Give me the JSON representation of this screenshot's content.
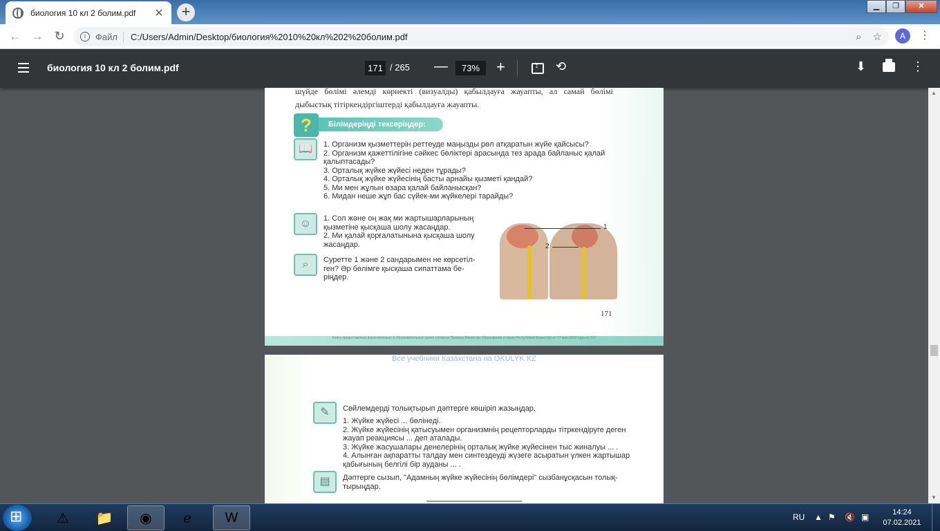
{
  "browser": {
    "tab_title": "биология 10 кл 2 болим.pdf",
    "scheme_label": "Файл",
    "url": "C:/Users/Admin/Desktop/биология%2010%20кл%202%20болим.pdf",
    "profile_initial": "A"
  },
  "pdf_toolbar": {
    "title": "биология 10 кл 2 болим.pdf",
    "current_page": "171",
    "total_pages": "/ 265",
    "zoom": "73%"
  },
  "page1": {
    "intro": "шүйде бөлімі әлемді көрнекті (визуалды) қабылдауға жауапты, ал самай бөлімі дыбыстық тітіркендіргіштерді қабылдауға жауапты.",
    "banner": "Білімдеріңді тексеріңдер:",
    "questions": [
      "1. Организм қызметтерін реттеуде маңызды рөл атқаратын жүйе қайсысы?",
      "2. Организм қажеттілігіне сәйкес бөліктері арасында тез арада байланыс қалай қалыптасады?",
      "3. Орталық жүйке жүйесі неден тұрады?",
      "4. Орталық жүйке жүйесінің басты арнайы қызметі қандай?",
      "5. Ми мен жұлын өзара қалай байланысқан?",
      "6. Мидан неше жұп бас сүйек-ми жүйкелері тарайды?"
    ],
    "tasks": [
      "1. Сол және оң жақ ми жартышарларының қызметіне қысқаша шолу жасаңдар.",
      "2. Ми қалай қорғалатынына қысқаша шолу жасаңдар."
    ],
    "figure_task": "Суретте 1 және 2 сандарымен не көрсетіл-ген? Әр бөлімге қысқаша сипаттама бе-ріңдер.",
    "figure_label_1": "1",
    "figure_label_2": "2",
    "page_number": "171",
    "footer": "Книга предоставлена исключительно в образовательных целях согласно Приказа Министра образования и науки Республики Казахстан от 17 мая 2019 года № 217"
  },
  "page2": {
    "watermark": "Все учебники Казахстана на OKULYK.KZ",
    "heading": "Сөйлемдерді толықтырып дәптерге көшіріп жазыңдар.",
    "items": [
      "1. Жүйке жүйесі ... бөлінеді.",
      "2. Жүйке жүйесінің қатысуымен организмнің рецепторларды тітркендіруге деген жауап реакциясы ... деп аталады.",
      "3. Жүйке жасушалары денелерінің орталық жүйке жүйесінен тыс жиналуы ... .",
      "4. Алынған ақпаратты талдау мен синтездеуді жүзеге асыратын үлкен жартышар қабығының белгілі бір ауданы ... ."
    ],
    "task": "Дәптерге сызып, \"Адамның жүйке жүйесінің бөлімдері\" сызбанұсқасын толық-тырыңдар."
  },
  "taskbar": {
    "lang": "RU",
    "time": "14:24",
    "date": "07.02.2021"
  }
}
